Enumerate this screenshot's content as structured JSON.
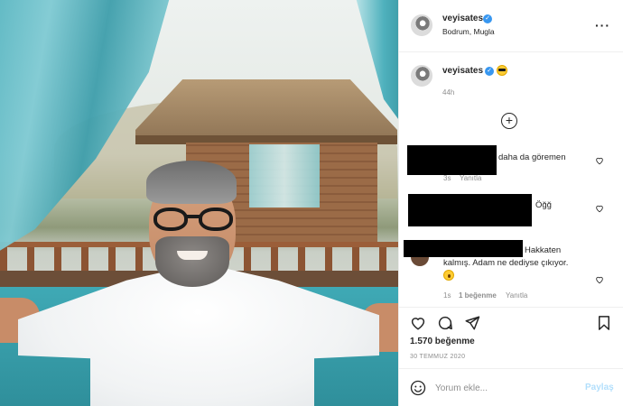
{
  "post": {
    "photo_alt": "",
    "header": {
      "username": "veyisates",
      "location": "Bodrum, Mugla",
      "more_icon": "more-horizontal-icon"
    },
    "caption": {
      "username": "veyisates",
      "emoji": "sunglasses-emoji",
      "time": "44h"
    },
    "load_more_icon": "plus-circle-icon",
    "comments": [
      {
        "text": "daha da göremen",
        "time": "3s",
        "reply": "Yanıtla",
        "redacted": true
      },
      {
        "text": "Öğğ",
        "redacted": true
      },
      {
        "text_line1": "Hakkaten",
        "text_line2": "kalmış. Adam ne dediyse çıkıyor.",
        "emoji": "surprised-emoji",
        "time": "1s",
        "likes": "1 beğenme",
        "reply": "Yanıtla",
        "redacted": true
      }
    ],
    "actions": {
      "like_icon": "heart-icon",
      "comment_icon": "comment-icon",
      "share_icon": "paper-plane-icon",
      "save_icon": "bookmark-icon"
    },
    "likes": "1.570 beğenme",
    "date": "30 TEMMUZ 2020",
    "add_comment": {
      "placeholder": "Yorum ekle...",
      "post_label": "Paylaş"
    }
  },
  "colors": {
    "verified": "#3897f0",
    "text": "#262626",
    "muted": "#8e8e8e",
    "post_disabled": "#b2dffc",
    "curtain": "#4fb1bd"
  }
}
